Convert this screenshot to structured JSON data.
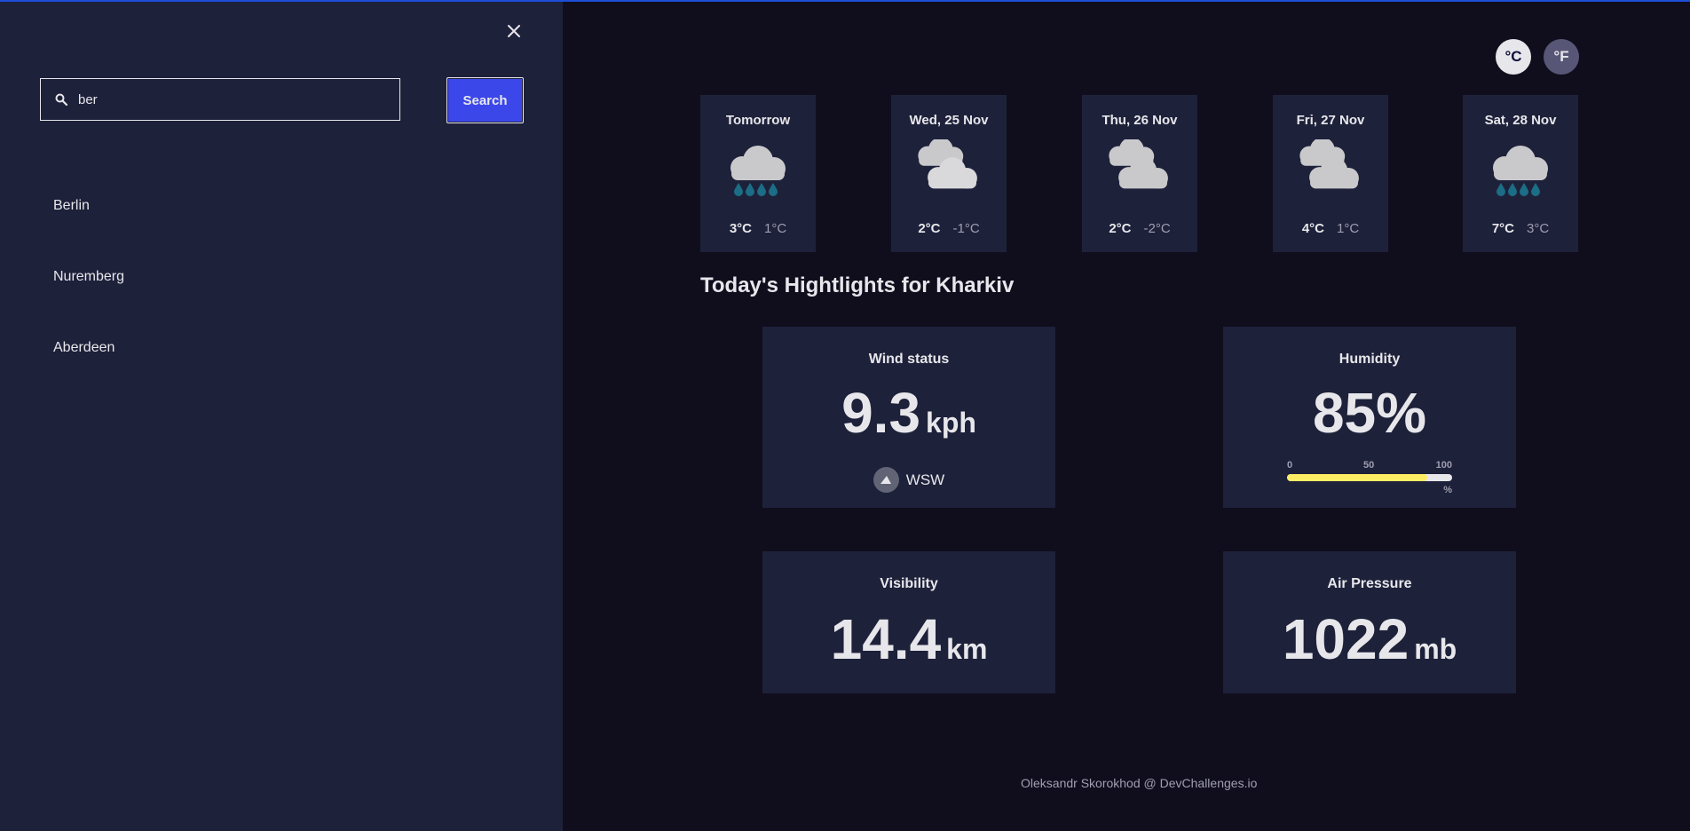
{
  "sidebar": {
    "search_value": "ber",
    "search_button": "Search",
    "results": [
      "Berlin",
      "Nuremberg",
      "Aberdeen"
    ]
  },
  "units": {
    "celsius": "°C",
    "fahrenheit": "°F"
  },
  "forecast": [
    {
      "day": "Tomorrow",
      "icon": "light-rain",
      "max": "3°C",
      "min": "1°C"
    },
    {
      "day": "Wed, 25 Nov",
      "icon": "heavy-cloud",
      "max": "2°C",
      "min": "-1°C"
    },
    {
      "day": "Thu, 26 Nov",
      "icon": "heavy-cloud",
      "max": "2°C",
      "min": "-2°C"
    },
    {
      "day": "Fri, 27 Nov",
      "icon": "heavy-cloud",
      "max": "4°C",
      "min": "1°C"
    },
    {
      "day": "Sat, 28 Nov",
      "icon": "light-rain",
      "max": "7°C",
      "min": "3°C"
    }
  ],
  "highlights": {
    "title": "Today's Hightlights for Kharkiv",
    "wind": {
      "label": "Wind status",
      "value": "9.3",
      "unit": "kph",
      "direction": "WSW"
    },
    "humidity": {
      "label": "Humidity",
      "value": "85%",
      "percent": 85,
      "scale_0": "0",
      "scale_50": "50",
      "scale_100": "100",
      "scale_unit": "%"
    },
    "visibility": {
      "label": "Visibility",
      "value": "14.4",
      "unit": "km"
    },
    "pressure": {
      "label": "Air Pressure",
      "value": "1022",
      "unit": "mb"
    }
  },
  "footer": "Oleksandr Skorokhod @ DevChallenges.io",
  "colors": {
    "accent": "#3c47e9",
    "bar": "#ffec65",
    "panel": "#1e213a",
    "bg": "#100e1d"
  }
}
